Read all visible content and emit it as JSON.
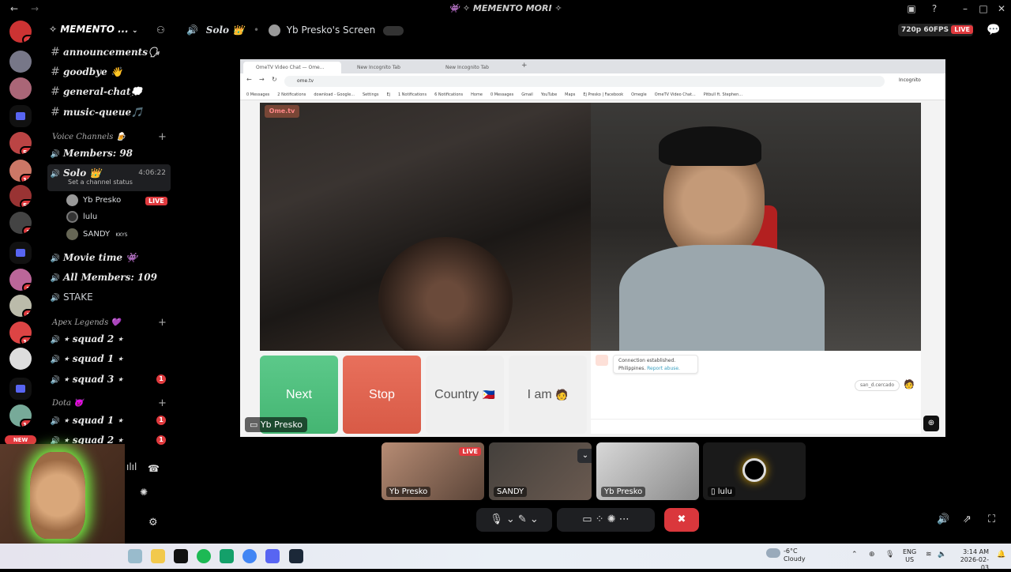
{
  "window": {
    "title": "👾 ✧ MEMENTO MORI ✧",
    "back_icon": "←",
    "forward_icon": "→"
  },
  "rail": {
    "servers": [
      {
        "badge": "4"
      },
      {
        "badge": ""
      },
      {
        "badge": ""
      },
      {
        "badge": ""
      },
      {
        "badge": "54"
      },
      {
        "badge": "18"
      },
      {
        "badge": "59"
      },
      {
        "badge": "2"
      },
      {
        "badge": ""
      },
      {
        "badge": "7"
      },
      {
        "badge": "1"
      },
      {
        "badge": "10"
      },
      {
        "badge": ""
      },
      {
        "badge": ""
      },
      {
        "badge": "14"
      }
    ],
    "new_label": "NEW"
  },
  "guild": {
    "name": "✧ MEMENTO ...",
    "text_channels": [
      {
        "name": "announcements🗣"
      },
      {
        "name": "goodbye 👋"
      },
      {
        "name": "general-chat💭"
      },
      {
        "name": "music-queue🎵"
      }
    ],
    "voice_category": "Voice Channels 🍺",
    "members_channel": "Members: 98",
    "active_voice": {
      "name": "Solo 👑",
      "timer": "4:06:22",
      "status": "Set a channel status"
    },
    "voice_users": [
      {
        "name": "Yb Presko",
        "live": "LIVE"
      },
      {
        "name": "lulu",
        "live": ""
      },
      {
        "name": "SANDY",
        "tag": "KKYS"
      }
    ],
    "more_voice": [
      {
        "name": "Movie time 👾"
      },
      {
        "name": "All Members: 109"
      },
      {
        "name": "STAKE"
      }
    ],
    "apex_category": "Apex Legends 💜",
    "apex_channels": [
      {
        "name": "⋆ squad 2 ⋆",
        "badge": ""
      },
      {
        "name": "⋆ squad 1 ⋆",
        "badge": ""
      },
      {
        "name": "⋆ squad 3 ⋆",
        "badge": "1"
      }
    ],
    "dota_category": "Dota 👿",
    "dota_channels": [
      {
        "name": "⋆ squad 1 ⋆",
        "badge": "1"
      },
      {
        "name": "⋆ squad 2 ⋆",
        "badge": "1"
      }
    ]
  },
  "header": {
    "channel": "Solo 👑",
    "screen_title": "Yb Presko's Screen",
    "quality": "720p 60FPS",
    "live": "LIVE"
  },
  "browser": {
    "tabs": [
      "OmeTV Video Chat — Ome...",
      "New Incognito Tab",
      "New Incognito Tab"
    ],
    "url": "ome.tv",
    "incognito": "Incognito",
    "bookmarks": [
      "0 Messages",
      "2 Notifications",
      "download - Google...",
      "Settings",
      "Ej",
      "1 Notifications",
      "6 Notifications",
      "Home",
      "0 Messages",
      "Gmail",
      "YouTube",
      "Maps",
      "Ej Presko | Facebook",
      "Omegle",
      "OmeTV Video Chat...",
      "Pitbull ft. Stephen..."
    ]
  },
  "ome": {
    "logo": "Ome.tv",
    "next": "Next",
    "stop": "Stop",
    "country": "Country",
    "i_am": "I am",
    "conn_msg": "Connection established.",
    "conn_country": "Philippines.",
    "report": "Report abuse.",
    "username": "san_d.cercado",
    "stream_label": "Yb Presko"
  },
  "tiles": [
    {
      "label": "Yb Presko",
      "live": "LIVE"
    },
    {
      "label": "SANDY"
    },
    {
      "label": "Yb Presko"
    },
    {
      "label": "lulu"
    }
  ],
  "taskbar": {
    "temp": "-6°C",
    "weather": "Cloudy",
    "lang1": "ENG",
    "lang2": "US",
    "time": "3:14 AM",
    "date": "2026-02-03"
  },
  "colors": {
    "next": "#5cc98a",
    "stop": "#e8705c",
    "live": "#e03a3e",
    "end_call": "#da373c"
  }
}
